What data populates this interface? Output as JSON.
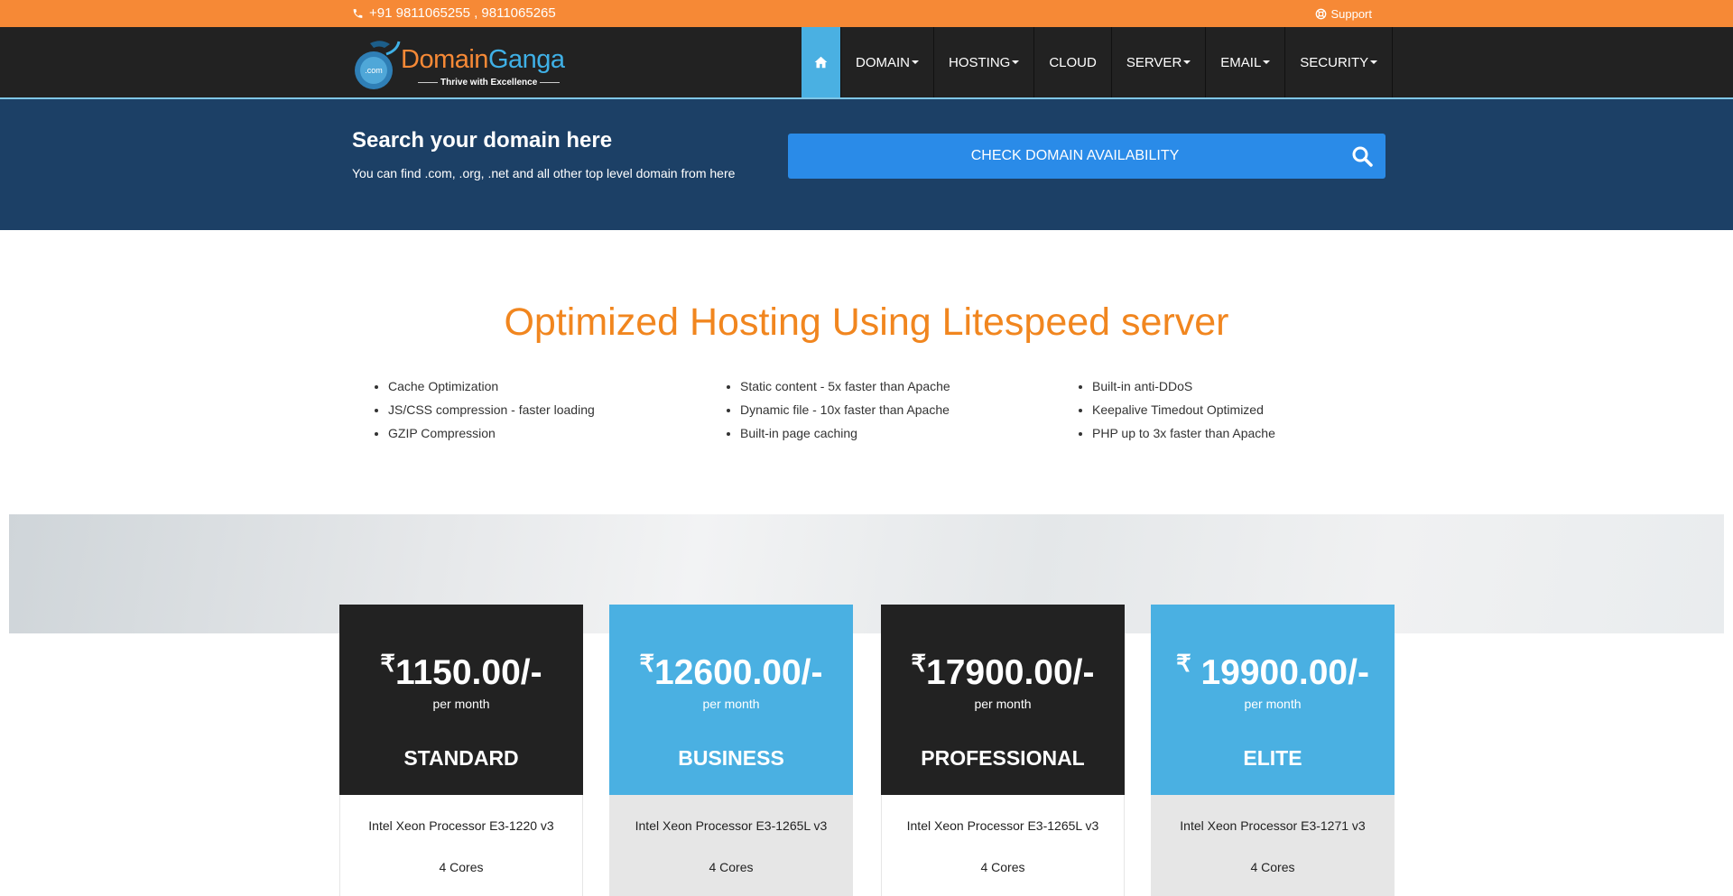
{
  "topbar": {
    "phone": "+91 9811065255 , 9811065265",
    "support": "Support",
    "phone_icon": "phone-icon",
    "support_icon": "lifebuoy-icon"
  },
  "logo": {
    "brand_part1": "Domain",
    "brand_part2": "Ganga",
    "tagline": "Thrive with Excellence",
    "globe_text": ".com"
  },
  "nav": {
    "home_icon": "home-icon",
    "items": [
      {
        "label": "DOMAIN",
        "dropdown": true
      },
      {
        "label": "HOSTING",
        "dropdown": true
      },
      {
        "label": "CLOUD",
        "dropdown": false
      },
      {
        "label": "SERVER",
        "dropdown": true
      },
      {
        "label": "EMAIL",
        "dropdown": true
      },
      {
        "label": "SECURITY",
        "dropdown": true
      }
    ]
  },
  "search": {
    "title": "Search your domain here",
    "subtitle": "You can find .com, .org, .net and all other top level domain from here",
    "button_label": "CHECK DOMAIN AVAILABILITY"
  },
  "heading": "Optimized Hosting Using Litespeed server",
  "features": [
    [
      "Cache Optimization",
      "JS/CSS compression - faster loading",
      "GZIP Compression"
    ],
    [
      "Static content - 5x faster than Apache",
      "Dynamic file - 10x faster than Apache",
      "Built-in page caching"
    ],
    [
      "Built-in anti-DDoS",
      "Keepalive Timedout Optimized",
      "PHP up to 3x faster than Apache"
    ]
  ],
  "plans": [
    {
      "currency": "₹",
      "price": "1150.00/-",
      "period": "per month",
      "name": "STANDARD",
      "processor": "Intel Xeon Processor E3-1220 v3",
      "cores": "4 Cores"
    },
    {
      "currency": "₹",
      "price": "12600.00/-",
      "period": "per month",
      "name": "BUSINESS",
      "processor": "Intel Xeon Processor E3-1265L v3",
      "cores": "4 Cores"
    },
    {
      "currency": "₹",
      "price": "17900.00/-",
      "period": "per month",
      "name": "PROFESSIONAL",
      "processor": "Intel Xeon Processor E3-1265L v3",
      "cores": "4 Cores"
    },
    {
      "currency": "₹",
      "price": " 19900.00/-",
      "period": "per month",
      "name": "ELITE",
      "processor": "Intel Xeon Processor E3-1271 v3",
      "cores": "4 Cores"
    }
  ],
  "colors": {
    "topbar": "#f68936",
    "nav": "#222222",
    "accent_blue": "#4ab0e2",
    "search_band": "#1c4066",
    "search_button": "#2a8be8",
    "heading": "#f1861f"
  }
}
